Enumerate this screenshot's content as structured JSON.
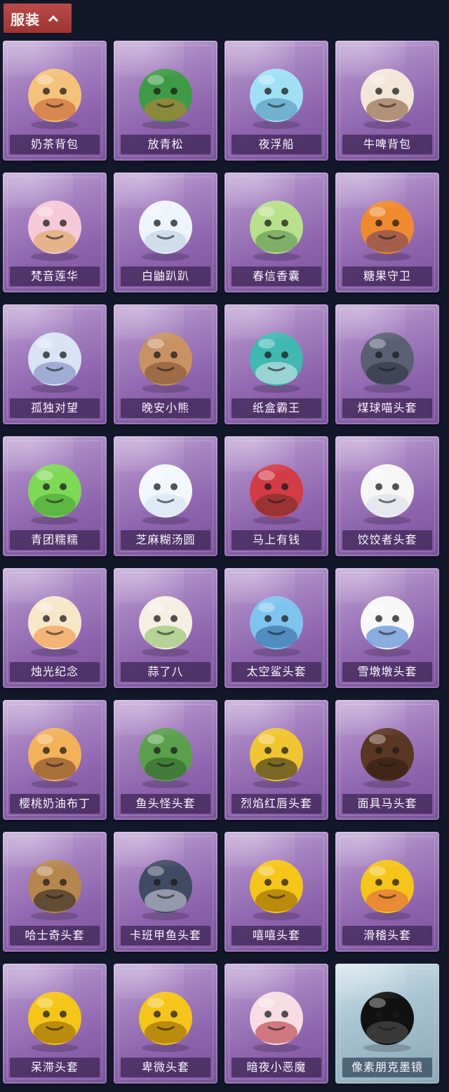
{
  "header": {
    "title": "服装",
    "accent": "#a83c39"
  },
  "items": [
    {
      "name": "奶茶背包",
      "icon": "milk-tea-backpack-icon"
    },
    {
      "name": "放青松",
      "icon": "potted-pine-icon"
    },
    {
      "name": "夜浮船",
      "icon": "jellyfish-icon"
    },
    {
      "name": "牛啤背包",
      "icon": "cow-beer-barrel-icon"
    },
    {
      "name": "梵音莲华",
      "icon": "lotus-character-icon"
    },
    {
      "name": "白鼬趴趴",
      "icon": "white-weasel-icon"
    },
    {
      "name": "春信香囊",
      "icon": "sachet-icon"
    },
    {
      "name": "糖果守卫",
      "icon": "pumpkin-scarecrow-icon"
    },
    {
      "name": "孤独对望",
      "icon": "lonely-character-icon"
    },
    {
      "name": "晚安小熊",
      "icon": "bear-charm-icon"
    },
    {
      "name": "纸盒霸王",
      "icon": "cardboard-dinosaur-icon"
    },
    {
      "name": "煤球喵头套",
      "icon": "black-cat-head-icon"
    },
    {
      "name": "青团糯糯",
      "icon": "green-dumpling-icon"
    },
    {
      "name": "芝麻糊汤圆",
      "icon": "white-dumpling-icon"
    },
    {
      "name": "马上有钱",
      "icon": "red-horse-head-icon"
    },
    {
      "name": "饺饺者头套",
      "icon": "dumpling-cloud-head-icon"
    },
    {
      "name": "烛光纪念",
      "icon": "candle-icon"
    },
    {
      "name": "蒜了八",
      "icon": "garlic-icon"
    },
    {
      "name": "太空鲨头套",
      "icon": "shark-head-icon"
    },
    {
      "name": "雪墩墩头套",
      "icon": "snowman-head-icon"
    },
    {
      "name": "樱桃奶油布丁",
      "icon": "pudding-icon"
    },
    {
      "name": "鱼头怪头套",
      "icon": "fish-head-icon"
    },
    {
      "name": "烈焰红唇头套",
      "icon": "yellow-mask-sunglasses-icon"
    },
    {
      "name": "面具马头套",
      "icon": "horse-mask-icon"
    },
    {
      "name": "哈士奇头套",
      "icon": "husky-head-icon"
    },
    {
      "name": "卡班甲鱼头套",
      "icon": "turtle-head-icon"
    },
    {
      "name": "嘻嘻头套",
      "icon": "grin-emoji-head-icon"
    },
    {
      "name": "滑稽头套",
      "icon": "smirk-emoji-head-icon"
    },
    {
      "name": "呆滞头套",
      "icon": "dazed-emoji-head-icon"
    },
    {
      "name": "卑微头套",
      "icon": "humble-emoji-head-icon"
    },
    {
      "name": "暗夜小恶魔",
      "icon": "little-devil-icon"
    },
    {
      "name": "像素朋克墨镜",
      "icon": "pixel-sunglasses-icon"
    }
  ]
}
